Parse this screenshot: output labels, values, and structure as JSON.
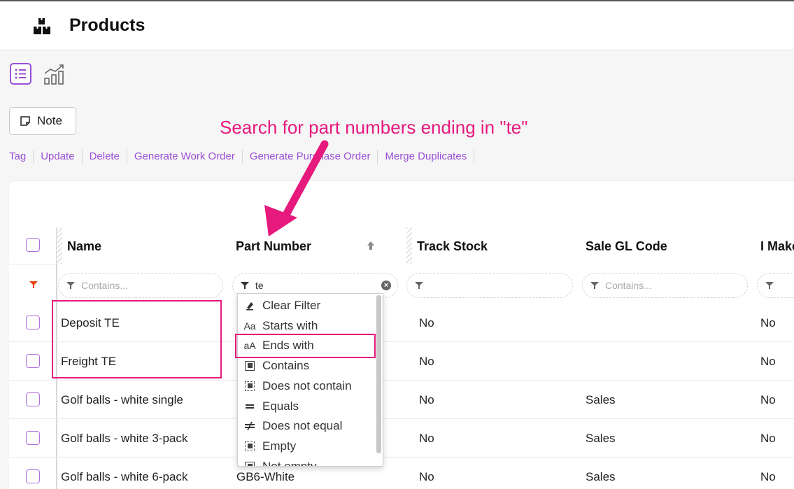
{
  "header": {
    "title": "Products"
  },
  "toolbar": {
    "note_label": "Note"
  },
  "actions": [
    "Tag",
    "Update",
    "Delete",
    "Generate Work Order",
    "Generate Purchase Order",
    "Merge Duplicates"
  ],
  "annotation": {
    "text": "Search for part numbers ending in \"te\"",
    "color": "#e6197d"
  },
  "table": {
    "columns": [
      "Name",
      "Part Number",
      "Track Stock",
      "Sale GL Code",
      "I Make"
    ],
    "filters": {
      "name_placeholder": "Contains...",
      "part_number_value": "te",
      "sale_gl_placeholder": "Contains..."
    },
    "rows": [
      {
        "name": "Deposit TE",
        "part_number": "",
        "track_stock": "No",
        "sale_gl": "",
        "i_make": "No"
      },
      {
        "name": "Freight TE",
        "part_number": "",
        "track_stock": "No",
        "sale_gl": "",
        "i_make": "No"
      },
      {
        "name": "Golf balls - white single",
        "part_number": "",
        "track_stock": "No",
        "sale_gl": "Sales",
        "i_make": "No"
      },
      {
        "name": "Golf balls - white 3-pack",
        "part_number": "",
        "track_stock": "No",
        "sale_gl": "Sales",
        "i_make": "No"
      },
      {
        "name": "Golf balls - white 6-pack",
        "part_number": "GB6-White",
        "track_stock": "No",
        "sale_gl": "Sales",
        "i_make": "No"
      }
    ]
  },
  "filter_menu": {
    "items": [
      "Clear Filter",
      "Starts with",
      "Ends with",
      "Contains",
      "Does not contain",
      "Equals",
      "Does not equal",
      "Empty",
      "Not empty"
    ]
  },
  "colors": {
    "accent": "#9b4fd6",
    "highlight": "#e6197d"
  }
}
